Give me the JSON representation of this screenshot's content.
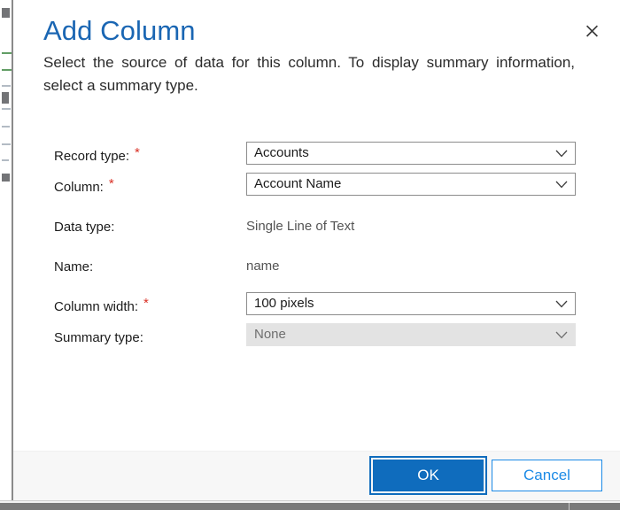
{
  "dialog": {
    "title": "Add Column",
    "subtitle": "Select the source of data for this column. To display summary information, select a summary type.",
    "close_icon": "close-icon",
    "required_marker": "*"
  },
  "form": {
    "rows": [
      {
        "label": "Record type:",
        "required": true,
        "control": "dropdown",
        "value": "Accounts",
        "disabled": false,
        "name": "record-type"
      },
      {
        "label": "Column:",
        "required": true,
        "control": "dropdown",
        "value": "Account Name",
        "disabled": false,
        "name": "column"
      },
      {
        "label": "Data type:",
        "required": false,
        "control": "static",
        "value": "Single Line of Text",
        "disabled": false,
        "name": "data-type"
      },
      {
        "label": "Name:",
        "required": false,
        "control": "static",
        "value": "name",
        "disabled": false,
        "name": "name"
      },
      {
        "label": "Column width:",
        "required": true,
        "control": "dropdown",
        "value": "100 pixels",
        "disabled": false,
        "name": "column-width"
      },
      {
        "label": "Summary type:",
        "required": false,
        "control": "dropdown",
        "value": "None",
        "disabled": true,
        "name": "summary-type"
      }
    ]
  },
  "footer": {
    "ok_label": "OK",
    "cancel_label": "Cancel"
  },
  "colors": {
    "title_blue": "#1a66b3",
    "primary_button": "#0f6cbd",
    "link_blue": "#1b8ae6",
    "required_red": "#d93025",
    "disabled_bg": "#e3e3e3",
    "footer_bg": "#f7f7f7"
  }
}
